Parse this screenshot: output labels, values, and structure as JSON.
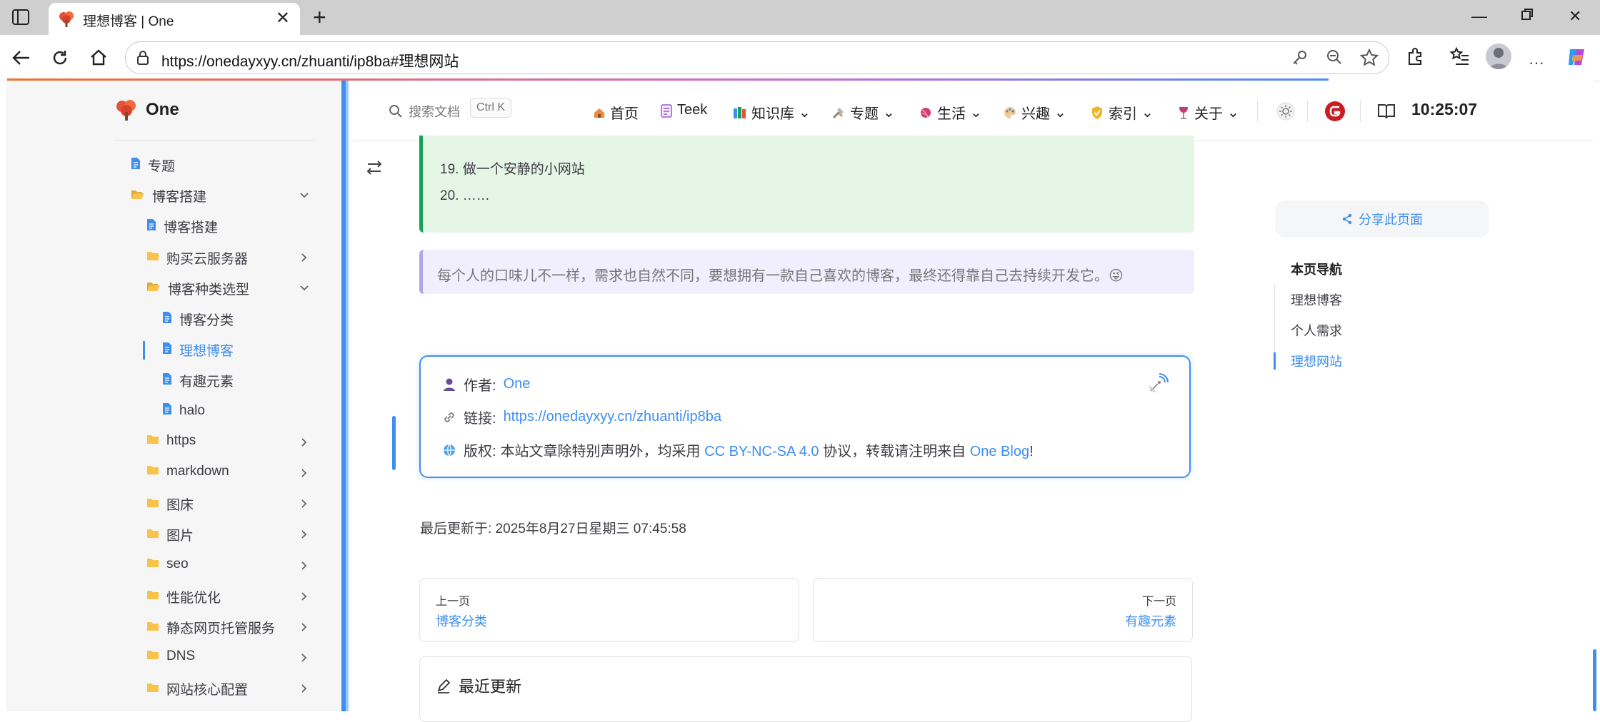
{
  "browser": {
    "tab_title": "理想博客 | One",
    "url": "https://onedayxyy.cn/zhuanti/ip8ba#理想网站"
  },
  "site": {
    "name": "One",
    "search_placeholder": "搜索文档",
    "search_shortcut": "Ctrl K",
    "nav": [
      {
        "label": "首页"
      },
      {
        "label": "Teek"
      },
      {
        "label": "知识库"
      },
      {
        "label": "专题"
      },
      {
        "label": "生活"
      },
      {
        "label": "兴趣"
      },
      {
        "label": "索引"
      },
      {
        "label": "关于"
      }
    ],
    "clock": "10:25:07"
  },
  "sidebar": {
    "items": [
      {
        "label": "专题",
        "kind": "doc"
      },
      {
        "label": "博客搭建",
        "kind": "folder-open"
      },
      {
        "label": "博客搭建",
        "kind": "doc"
      },
      {
        "label": "购买云服务器",
        "kind": "folder"
      },
      {
        "label": "博客种类选型",
        "kind": "folder-open"
      },
      {
        "label": "博客分类",
        "kind": "doc"
      },
      {
        "label": "理想博客",
        "kind": "doc",
        "active": true
      },
      {
        "label": "有趣元素",
        "kind": "doc"
      },
      {
        "label": "halo",
        "kind": "doc"
      },
      {
        "label": "https",
        "kind": "folder"
      },
      {
        "label": "markdown",
        "kind": "folder"
      },
      {
        "label": "图床",
        "kind": "folder"
      },
      {
        "label": "图片",
        "kind": "folder"
      },
      {
        "label": "seo",
        "kind": "folder"
      },
      {
        "label": "性能优化",
        "kind": "folder"
      },
      {
        "label": "静态网页托管服务",
        "kind": "folder"
      },
      {
        "label": "DNS",
        "kind": "folder"
      },
      {
        "label": "网站核心配置",
        "kind": "folder"
      }
    ]
  },
  "content": {
    "list_items": [
      "19. 做一个安静的小网站",
      "20. ……"
    ],
    "tip": "每个人的口味儿不一样，需求也自然不同，要想拥有一款自己喜欢的博客，最终还得靠自己去持续开发它。😜",
    "copyright": {
      "author_label": "作者:",
      "author": "One",
      "link_label": "链接:",
      "link": "https://onedayxyy.cn/zhuanti/ip8ba",
      "license_label": "版权:",
      "license_prefix": "本站文章除特别声明外，均采用",
      "license_name": "CC BY-NC-SA 4.0",
      "license_mid": "协议，转载请注明来自",
      "license_site": "One Blog",
      "license_suffix": "!"
    },
    "last_updated": "最后更新于: 2025年8月27日星期三 07:45:58",
    "prev": {
      "label": "上一页",
      "title": "博客分类"
    },
    "next": {
      "label": "下一页",
      "title": "有趣元素"
    },
    "recent_title": "最近更新"
  },
  "aside": {
    "share": "分享此页面",
    "outline_title": "本页导航",
    "outline": [
      {
        "label": "理想博客"
      },
      {
        "label": "个人需求"
      },
      {
        "label": "理想网站",
        "active": true
      }
    ]
  }
}
